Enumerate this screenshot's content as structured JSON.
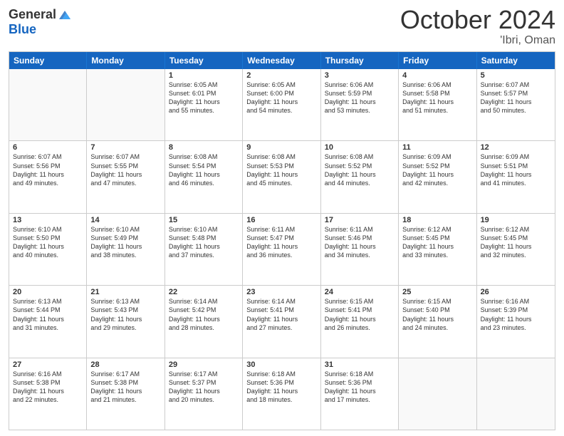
{
  "header": {
    "logo_general": "General",
    "logo_blue": "Blue",
    "month_title": "October 2024",
    "location": "'Ibri, Oman"
  },
  "weekdays": [
    "Sunday",
    "Monday",
    "Tuesday",
    "Wednesday",
    "Thursday",
    "Friday",
    "Saturday"
  ],
  "rows": [
    [
      {
        "day": "",
        "empty": true
      },
      {
        "day": "",
        "empty": true
      },
      {
        "day": "1",
        "lines": [
          "Sunrise: 6:05 AM",
          "Sunset: 6:01 PM",
          "Daylight: 11 hours",
          "and 55 minutes."
        ]
      },
      {
        "day": "2",
        "lines": [
          "Sunrise: 6:05 AM",
          "Sunset: 6:00 PM",
          "Daylight: 11 hours",
          "and 54 minutes."
        ]
      },
      {
        "day": "3",
        "lines": [
          "Sunrise: 6:06 AM",
          "Sunset: 5:59 PM",
          "Daylight: 11 hours",
          "and 53 minutes."
        ]
      },
      {
        "day": "4",
        "lines": [
          "Sunrise: 6:06 AM",
          "Sunset: 5:58 PM",
          "Daylight: 11 hours",
          "and 51 minutes."
        ]
      },
      {
        "day": "5",
        "lines": [
          "Sunrise: 6:07 AM",
          "Sunset: 5:57 PM",
          "Daylight: 11 hours",
          "and 50 minutes."
        ]
      }
    ],
    [
      {
        "day": "6",
        "lines": [
          "Sunrise: 6:07 AM",
          "Sunset: 5:56 PM",
          "Daylight: 11 hours",
          "and 49 minutes."
        ]
      },
      {
        "day": "7",
        "lines": [
          "Sunrise: 6:07 AM",
          "Sunset: 5:55 PM",
          "Daylight: 11 hours",
          "and 47 minutes."
        ]
      },
      {
        "day": "8",
        "lines": [
          "Sunrise: 6:08 AM",
          "Sunset: 5:54 PM",
          "Daylight: 11 hours",
          "and 46 minutes."
        ]
      },
      {
        "day": "9",
        "lines": [
          "Sunrise: 6:08 AM",
          "Sunset: 5:53 PM",
          "Daylight: 11 hours",
          "and 45 minutes."
        ]
      },
      {
        "day": "10",
        "lines": [
          "Sunrise: 6:08 AM",
          "Sunset: 5:52 PM",
          "Daylight: 11 hours",
          "and 44 minutes."
        ]
      },
      {
        "day": "11",
        "lines": [
          "Sunrise: 6:09 AM",
          "Sunset: 5:52 PM",
          "Daylight: 11 hours",
          "and 42 minutes."
        ]
      },
      {
        "day": "12",
        "lines": [
          "Sunrise: 6:09 AM",
          "Sunset: 5:51 PM",
          "Daylight: 11 hours",
          "and 41 minutes."
        ]
      }
    ],
    [
      {
        "day": "13",
        "lines": [
          "Sunrise: 6:10 AM",
          "Sunset: 5:50 PM",
          "Daylight: 11 hours",
          "and 40 minutes."
        ]
      },
      {
        "day": "14",
        "lines": [
          "Sunrise: 6:10 AM",
          "Sunset: 5:49 PM",
          "Daylight: 11 hours",
          "and 38 minutes."
        ]
      },
      {
        "day": "15",
        "lines": [
          "Sunrise: 6:10 AM",
          "Sunset: 5:48 PM",
          "Daylight: 11 hours",
          "and 37 minutes."
        ]
      },
      {
        "day": "16",
        "lines": [
          "Sunrise: 6:11 AM",
          "Sunset: 5:47 PM",
          "Daylight: 11 hours",
          "and 36 minutes."
        ]
      },
      {
        "day": "17",
        "lines": [
          "Sunrise: 6:11 AM",
          "Sunset: 5:46 PM",
          "Daylight: 11 hours",
          "and 34 minutes."
        ]
      },
      {
        "day": "18",
        "lines": [
          "Sunrise: 6:12 AM",
          "Sunset: 5:45 PM",
          "Daylight: 11 hours",
          "and 33 minutes."
        ]
      },
      {
        "day": "19",
        "lines": [
          "Sunrise: 6:12 AM",
          "Sunset: 5:45 PM",
          "Daylight: 11 hours",
          "and 32 minutes."
        ]
      }
    ],
    [
      {
        "day": "20",
        "lines": [
          "Sunrise: 6:13 AM",
          "Sunset: 5:44 PM",
          "Daylight: 11 hours",
          "and 31 minutes."
        ]
      },
      {
        "day": "21",
        "lines": [
          "Sunrise: 6:13 AM",
          "Sunset: 5:43 PM",
          "Daylight: 11 hours",
          "and 29 minutes."
        ]
      },
      {
        "day": "22",
        "lines": [
          "Sunrise: 6:14 AM",
          "Sunset: 5:42 PM",
          "Daylight: 11 hours",
          "and 28 minutes."
        ]
      },
      {
        "day": "23",
        "lines": [
          "Sunrise: 6:14 AM",
          "Sunset: 5:41 PM",
          "Daylight: 11 hours",
          "and 27 minutes."
        ]
      },
      {
        "day": "24",
        "lines": [
          "Sunrise: 6:15 AM",
          "Sunset: 5:41 PM",
          "Daylight: 11 hours",
          "and 26 minutes."
        ]
      },
      {
        "day": "25",
        "lines": [
          "Sunrise: 6:15 AM",
          "Sunset: 5:40 PM",
          "Daylight: 11 hours",
          "and 24 minutes."
        ]
      },
      {
        "day": "26",
        "lines": [
          "Sunrise: 6:16 AM",
          "Sunset: 5:39 PM",
          "Daylight: 11 hours",
          "and 23 minutes."
        ]
      }
    ],
    [
      {
        "day": "27",
        "lines": [
          "Sunrise: 6:16 AM",
          "Sunset: 5:38 PM",
          "Daylight: 11 hours",
          "and 22 minutes."
        ]
      },
      {
        "day": "28",
        "lines": [
          "Sunrise: 6:17 AM",
          "Sunset: 5:38 PM",
          "Daylight: 11 hours",
          "and 21 minutes."
        ]
      },
      {
        "day": "29",
        "lines": [
          "Sunrise: 6:17 AM",
          "Sunset: 5:37 PM",
          "Daylight: 11 hours",
          "and 20 minutes."
        ]
      },
      {
        "day": "30",
        "lines": [
          "Sunrise: 6:18 AM",
          "Sunset: 5:36 PM",
          "Daylight: 11 hours",
          "and 18 minutes."
        ]
      },
      {
        "day": "31",
        "lines": [
          "Sunrise: 6:18 AM",
          "Sunset: 5:36 PM",
          "Daylight: 11 hours",
          "and 17 minutes."
        ]
      },
      {
        "day": "",
        "empty": true
      },
      {
        "day": "",
        "empty": true
      }
    ]
  ]
}
